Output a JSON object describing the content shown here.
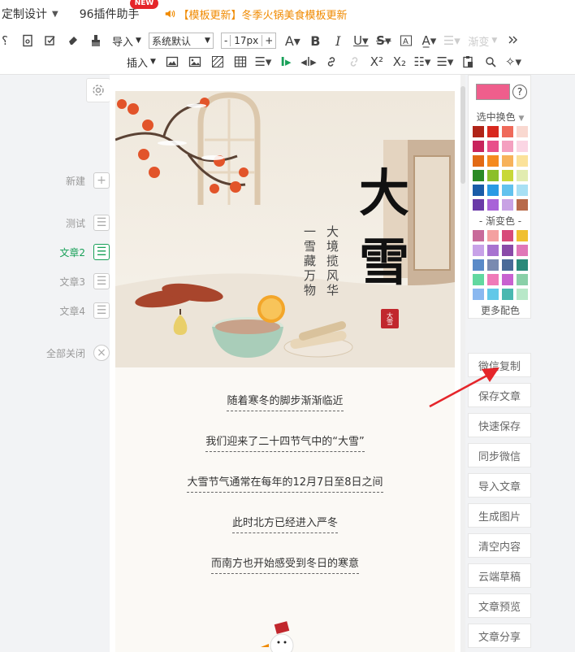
{
  "topbar": {
    "menu_label": "定制设计",
    "plugin_label": "96插件助手",
    "new_badge": "NEW",
    "notice": "【模板更新】冬季火锅美食模板更新"
  },
  "toolbar": {
    "import_label": "导入",
    "font_family": "系统默认",
    "font_size": "17px",
    "size_minus": "-",
    "size_plus": "+",
    "gradient_label": "渐变",
    "insert_label": "插入",
    "superscript": "X²",
    "subscript": "X₂"
  },
  "left_nav": {
    "items": [
      {
        "label": "新建",
        "icon": "plus-icon",
        "active": false
      },
      {
        "label": "测试",
        "icon": "document-icon",
        "active": false
      },
      {
        "label": "文章2",
        "icon": "document-icon",
        "active": true
      },
      {
        "label": "文章3",
        "icon": "document-icon",
        "active": false
      },
      {
        "label": "文章4",
        "icon": "document-icon",
        "active": false
      },
      {
        "label": "全部关闭",
        "icon": "close-circle-icon",
        "active": false
      }
    ]
  },
  "article": {
    "title_char1": "大",
    "title_char2": "雪",
    "subtitle_col1": "大境揽风华",
    "subtitle_col2": "一雪藏万物",
    "seal_text": "大雪",
    "lines": [
      "随着寒冬的脚步渐渐临近",
      "我们迎来了二十四节气中的“大雪”",
      "大雪节气通常在每年的12月7日至8日之间",
      "此时北方已经进入严冬",
      "而南方也开始感受到冬日的寒意"
    ]
  },
  "color_panel": {
    "selected_color": "#ef5e8c",
    "help": "?",
    "select_label": "选中换色",
    "gradient_label": "- 渐变色 -",
    "more_label": "更多配色",
    "solid_colors": [
      "#b02418",
      "#d8281e",
      "#ef6a5a",
      "#f9d8d0",
      "#c8245c",
      "#e8508a",
      "#f4a0c0",
      "#fbd6e4",
      "#e26a14",
      "#f58a1e",
      "#f7b25a",
      "#fbe29a",
      "#2a8a24",
      "#8cbf2a",
      "#c8d838",
      "#e2ecb0",
      "#1a5ca8",
      "#2a9ae4",
      "#62c2ee",
      "#a8e0f4",
      "#6a3aa8",
      "#a862d8",
      "#c8a2e4",
      "#b86a4a"
    ],
    "gradient_colors": [
      "#c86a9a",
      "#f4a0a0",
      "#d84a7a",
      "#f0c030",
      "#c8a2e8",
      "#a872d0",
      "#8a4aa8",
      "#e078b8",
      "#5a8ac8",
      "#7a8ab0",
      "#4a6a98",
      "#2a8a7a",
      "#62d8a0",
      "#f07ab8",
      "#c862d0",
      "#8ad0a8",
      "#8ab8f0",
      "#62c8e8",
      "#4ab8b0",
      "#b8e8c8"
    ]
  },
  "right_buttons": [
    "微信复制",
    "保存文章",
    "快速保存",
    "同步微信",
    "导入文章",
    "生成图片",
    "清空内容",
    "云端草稿",
    "文章预览",
    "文章分享"
  ]
}
